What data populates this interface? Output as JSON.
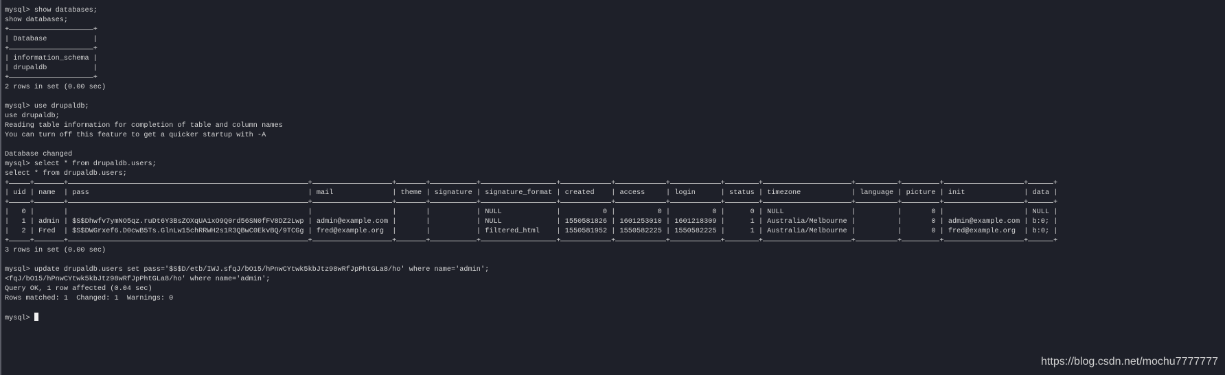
{
  "colors": {
    "background": "#1e2029",
    "text": "#d6d6d6"
  },
  "block1": [
    "mysql> show databases;",
    "show databases;"
  ],
  "db_table": {
    "headers": [
      "Database"
    ],
    "rows": [
      [
        "information_schema"
      ],
      [
        "drupaldb"
      ]
    ],
    "align": [
      "l"
    ]
  },
  "block2": [
    "2 rows in set (0.00 sec)",
    "",
    "mysql> use drupaldb;",
    "use drupaldb;",
    "Reading table information for completion of table and column names",
    "You can turn off this feature to get a quicker startup with -A",
    "",
    "Database changed",
    "mysql> select * from drupaldb.users;",
    "select * from drupaldb.users;"
  ],
  "users_table": {
    "headers": [
      "uid",
      "name",
      "pass",
      "mail",
      "theme",
      "signature",
      "signature_format",
      "created",
      "access",
      "login",
      "status",
      "timezone",
      "language",
      "picture",
      "init",
      "data"
    ],
    "align": [
      "r",
      "l",
      "l",
      "l",
      "l",
      "l",
      "l",
      "r",
      "r",
      "r",
      "r",
      "l",
      "l",
      "r",
      "l",
      "l"
    ],
    "rows": [
      [
        "0",
        "",
        "",
        "",
        "",
        "",
        "NULL",
        "0",
        "0",
        "0",
        "0",
        "NULL",
        "",
        "0",
        "",
        "NULL"
      ],
      [
        "1",
        "admin",
        "$S$Dhwfv7ymNO5qz.ruDt6Y3BsZOXqUA1xO9Q0rd56SN0fFV8DZ2Lwp",
        "admin@example.com",
        "",
        "",
        "NULL",
        "1550581826",
        "1601253010",
        "1601218309",
        "1",
        "Australia/Melbourne",
        "",
        "0",
        "admin@example.com",
        "b:0;"
      ],
      [
        "2",
        "Fred",
        "$S$DWGrxef6.D0cwB5Ts.GlnLw15chRRWH2s1R3QBwC0EkvBQ/9TCGg",
        "fred@example.org",
        "",
        "",
        "filtered_html",
        "1550581952",
        "1550582225",
        "1550582225",
        "1",
        "Australia/Melbourne",
        "",
        "0",
        "fred@example.org",
        "b:0;"
      ]
    ]
  },
  "block3": [
    "3 rows in set (0.00 sec)",
    "",
    "mysql> update drupaldb.users set pass='$S$D/etb/IWJ.sfqJ/bO15/hPnwCYtwk5kbJtz98wRfJpPhtGLa8/ho' where name='admin';",
    "<fqJ/bO15/hPnwCYtwk5kbJtz98wRfJpPhtGLa8/ho' where name='admin';",
    "Query OK, 1 row affected (0.04 sec)",
    "Rows matched: 1  Changed: 1  Warnings: 0",
    ""
  ],
  "prompt": "mysql> ",
  "watermark": "https://blog.csdn.net/mochu7777777"
}
